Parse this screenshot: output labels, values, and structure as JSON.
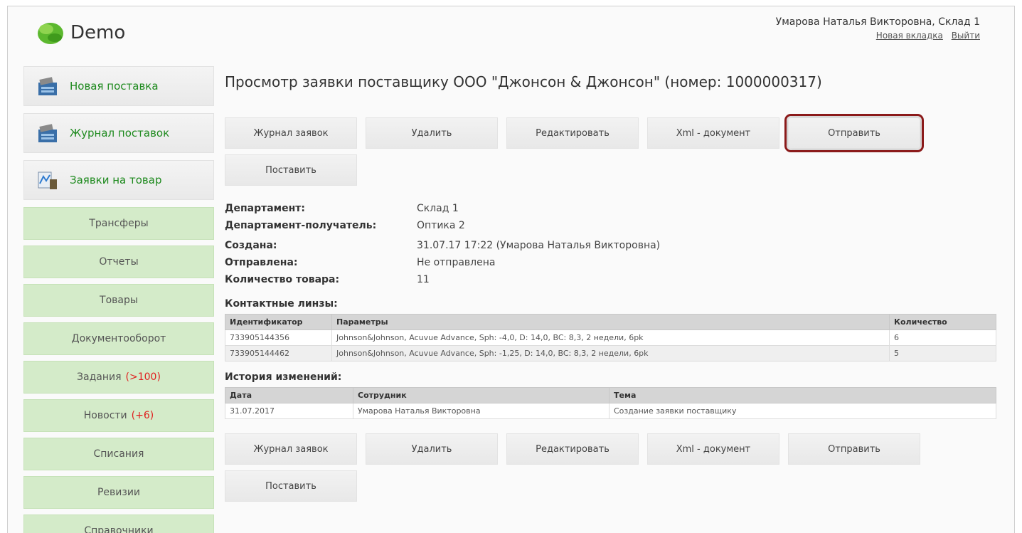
{
  "header": {
    "app_name": "Demo",
    "user": "Умарова Наталья Викторовна, Склад 1",
    "link_new_tab": "Новая вкладка",
    "link_logout": "Выйти"
  },
  "sidebar": {
    "main_items": [
      {
        "label": "Новая поставка",
        "icon": "delivery-icon"
      },
      {
        "label": "Журнал поставок",
        "icon": "delivery-log-icon"
      },
      {
        "label": "Заявки на товар",
        "icon": "chart-icon"
      }
    ],
    "items": [
      {
        "label": "Трансферы",
        "badge": ""
      },
      {
        "label": "Отчеты",
        "badge": ""
      },
      {
        "label": "Товары",
        "badge": ""
      },
      {
        "label": "Документооборот",
        "badge": ""
      },
      {
        "label": "Задания",
        "badge": "(>100)"
      },
      {
        "label": "Новости",
        "badge": "(+6)"
      },
      {
        "label": "Списания",
        "badge": ""
      },
      {
        "label": "Ревизии",
        "badge": ""
      },
      {
        "label": "Справочники",
        "badge": ""
      }
    ]
  },
  "page": {
    "title": "Просмотр заявки поставщику ООО \"Джонсон & Джонсон\" (номер: 1000000317)"
  },
  "buttons": {
    "journal": "Журнал заявок",
    "delete": "Удалить",
    "edit": "Редактировать",
    "xml": "Xml - документ",
    "send": "Отправить",
    "deliver": "Поставить"
  },
  "info": {
    "department_label": "Департамент:",
    "department_value": "Склад 1",
    "recipient_label": "Департамент-получатель:",
    "recipient_value": "Оптика 2",
    "created_label": "Создана:",
    "created_value": "31.07.17 17:22 (Умарова Наталья Викторовна)",
    "sent_label": "Отправлена:",
    "sent_value": "Не отправлена",
    "qty_label": "Количество товара:",
    "qty_value": "11"
  },
  "lenses": {
    "title": "Контактные линзы:",
    "columns": [
      "Идентификатор",
      "Параметры",
      "Количество"
    ],
    "rows": [
      [
        "733905144356",
        "Johnson&Johnson, Acuvue Advance, Sph: -4,0, D: 14,0, BC: 8,3, 2 недели, 6pk",
        "6"
      ],
      [
        "733905144462",
        "Johnson&Johnson, Acuvue Advance, Sph: -1,25, D: 14,0, BC: 8,3, 2 недели, 6pk",
        "5"
      ]
    ]
  },
  "history": {
    "title": "История изменений:",
    "columns": [
      "Дата",
      "Сотрудник",
      "Тема"
    ],
    "rows": [
      [
        "31.07.2017",
        "Умарова Наталья Викторовна",
        "Создание заявки поставщику"
      ]
    ]
  }
}
